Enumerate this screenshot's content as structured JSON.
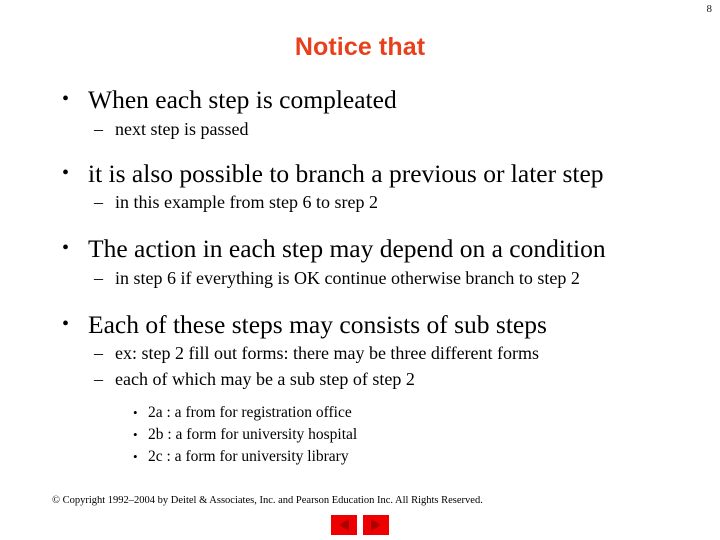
{
  "page_number": "8",
  "title": "Notice that",
  "colors": {
    "title": "#E8401C",
    "nav_button": "#EE0000",
    "nav_arrow": "#B00000",
    "text": "#000000",
    "background": "#FFFFFF"
  },
  "bullet_glyphs": {
    "level1": "•",
    "level2": "–",
    "level3": "•"
  },
  "content": [
    {
      "level1": "When each step is compleated",
      "level2": [
        {
          "text": "next step is passed"
        }
      ]
    },
    {
      "level1": "it is also possible to branch a previous or later step",
      "level2": [
        {
          "text": "in this example from step 6 to srep 2"
        }
      ]
    },
    {
      "level1": "The action in each step may depend on a condition",
      "level2": [
        {
          "text": "in step 6 if everything is OK continue otherwise branch to step 2"
        }
      ]
    },
    {
      "level1": "Each of these steps may consists of sub steps",
      "level2": [
        {
          "text": "ex: step 2 fill out forms: there may be three different forms"
        },
        {
          "text": "each of which may be a sub step of step 2"
        }
      ],
      "level3": [
        {
          "text": "2a : a from for registration office"
        },
        {
          "text": "2b : a form for university hospital"
        },
        {
          "text": "2c : a form for university library"
        }
      ]
    }
  ],
  "footer": {
    "copyright": "© Copyright 1992–2004 by Deitel & Associates, Inc. and Pearson Education Inc. All Rights Reserved."
  },
  "navigation": {
    "previous_label": "Previous slide",
    "next_label": "Next slide"
  }
}
